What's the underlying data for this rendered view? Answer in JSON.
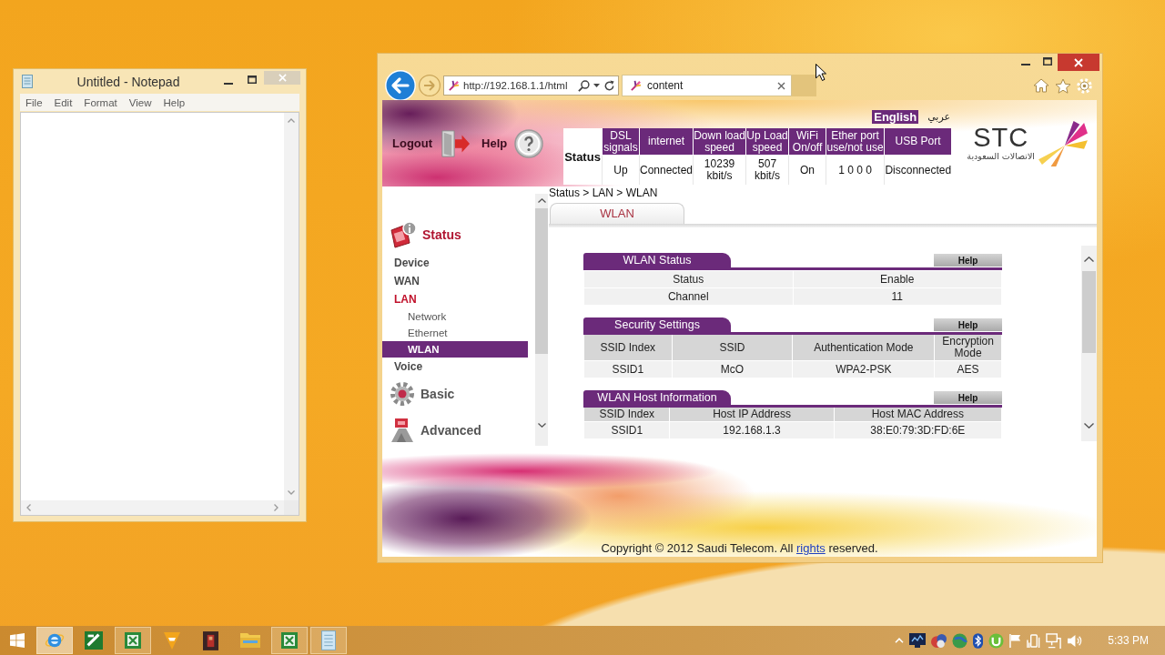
{
  "notepad": {
    "title": "Untitled - Notepad",
    "menu": [
      "File",
      "Edit",
      "Format",
      "View",
      "Help"
    ]
  },
  "browser": {
    "address": "http://192.168.1.1/html",
    "tabs": [
      {
        "label": "content",
        "selected": true
      }
    ]
  },
  "router": {
    "languages": [
      {
        "label": "English",
        "selected": true
      },
      {
        "label": "عربي",
        "selected": false
      }
    ],
    "header_links": [
      {
        "label": "Logout",
        "kind": "logout"
      },
      {
        "label": "Help",
        "kind": "help"
      }
    ],
    "status_bar": {
      "label": "Status",
      "columns": [
        "DSL signals",
        "internet",
        "Down load speed",
        "Up Load speed",
        "WiFi On/off",
        "Ether port use/not use",
        "USB Port"
      ],
      "values": [
        "Up",
        "Connected",
        "10239 kbit/s",
        "507 kbit/s",
        "On",
        "1 0 0 0",
        "Disconnected"
      ]
    },
    "logo": {
      "name": "STC",
      "tagline": "الاتصالات السعودية"
    },
    "sidebar": [
      {
        "label": "Status",
        "kind": "status",
        "expanded": true,
        "children": [
          {
            "label": "Device",
            "expanded": false
          },
          {
            "label": "WAN",
            "expanded": false
          },
          {
            "label": "LAN",
            "expanded": true,
            "children": [
              {
                "label": "Network",
                "selected": false
              },
              {
                "label": "Ethernet",
                "selected": false
              },
              {
                "label": "WLAN",
                "selected": true
              }
            ]
          },
          {
            "label": "Voice",
            "expanded": false
          }
        ]
      },
      {
        "label": "Basic",
        "kind": "basic",
        "expanded": false
      },
      {
        "label": "Advanced",
        "kind": "advanced",
        "expanded": false
      }
    ],
    "breadcrumb": "Status > LAN > WLAN",
    "tabs": [
      {
        "label": "WLAN",
        "selected": true
      }
    ],
    "panels": [
      {
        "title": "WLAN Status",
        "kind": "pairs",
        "help": "Help",
        "rows": [
          [
            "Status",
            "Enable"
          ],
          [
            "Channel",
            "11"
          ]
        ]
      },
      {
        "title": "Security Settings",
        "kind": "table",
        "help": "Help",
        "columns": [
          "SSID Index",
          "SSID",
          "Authentication Mode",
          "Encryption Mode"
        ],
        "rows": [
          [
            "SSID1",
            "McO",
            "WPA2-PSK",
            "AES"
          ]
        ]
      },
      {
        "title": "WLAN Host Information",
        "kind": "table",
        "help": "Help",
        "columns": [
          "SSID Index",
          "Host IP Address",
          "Host MAC Address"
        ],
        "rows": [
          [
            "SSID1",
            "192.168.1.3",
            "38:E0:79:3D:FD:6E"
          ]
        ]
      }
    ],
    "footer": {
      "text_before": "Copyright © 2012 Saudi Telecom. All",
      "link": "rights",
      "text_after": "reserved."
    }
  },
  "taskbar": {
    "apps": [
      {
        "kind": "browser",
        "running": true,
        "selected": true
      },
      {
        "kind": "archiver",
        "running": false,
        "selected": false
      },
      {
        "kind": "sheet",
        "running": true,
        "selected": false
      },
      {
        "kind": "player",
        "running": false,
        "selected": false
      },
      {
        "kind": "media",
        "running": false,
        "selected": false
      },
      {
        "kind": "folder",
        "running": false,
        "selected": false
      },
      {
        "kind": "sheet",
        "running": true,
        "selected": false
      },
      {
        "kind": "notepad",
        "running": true,
        "selected": false
      }
    ],
    "clock": "5:33 PM"
  }
}
